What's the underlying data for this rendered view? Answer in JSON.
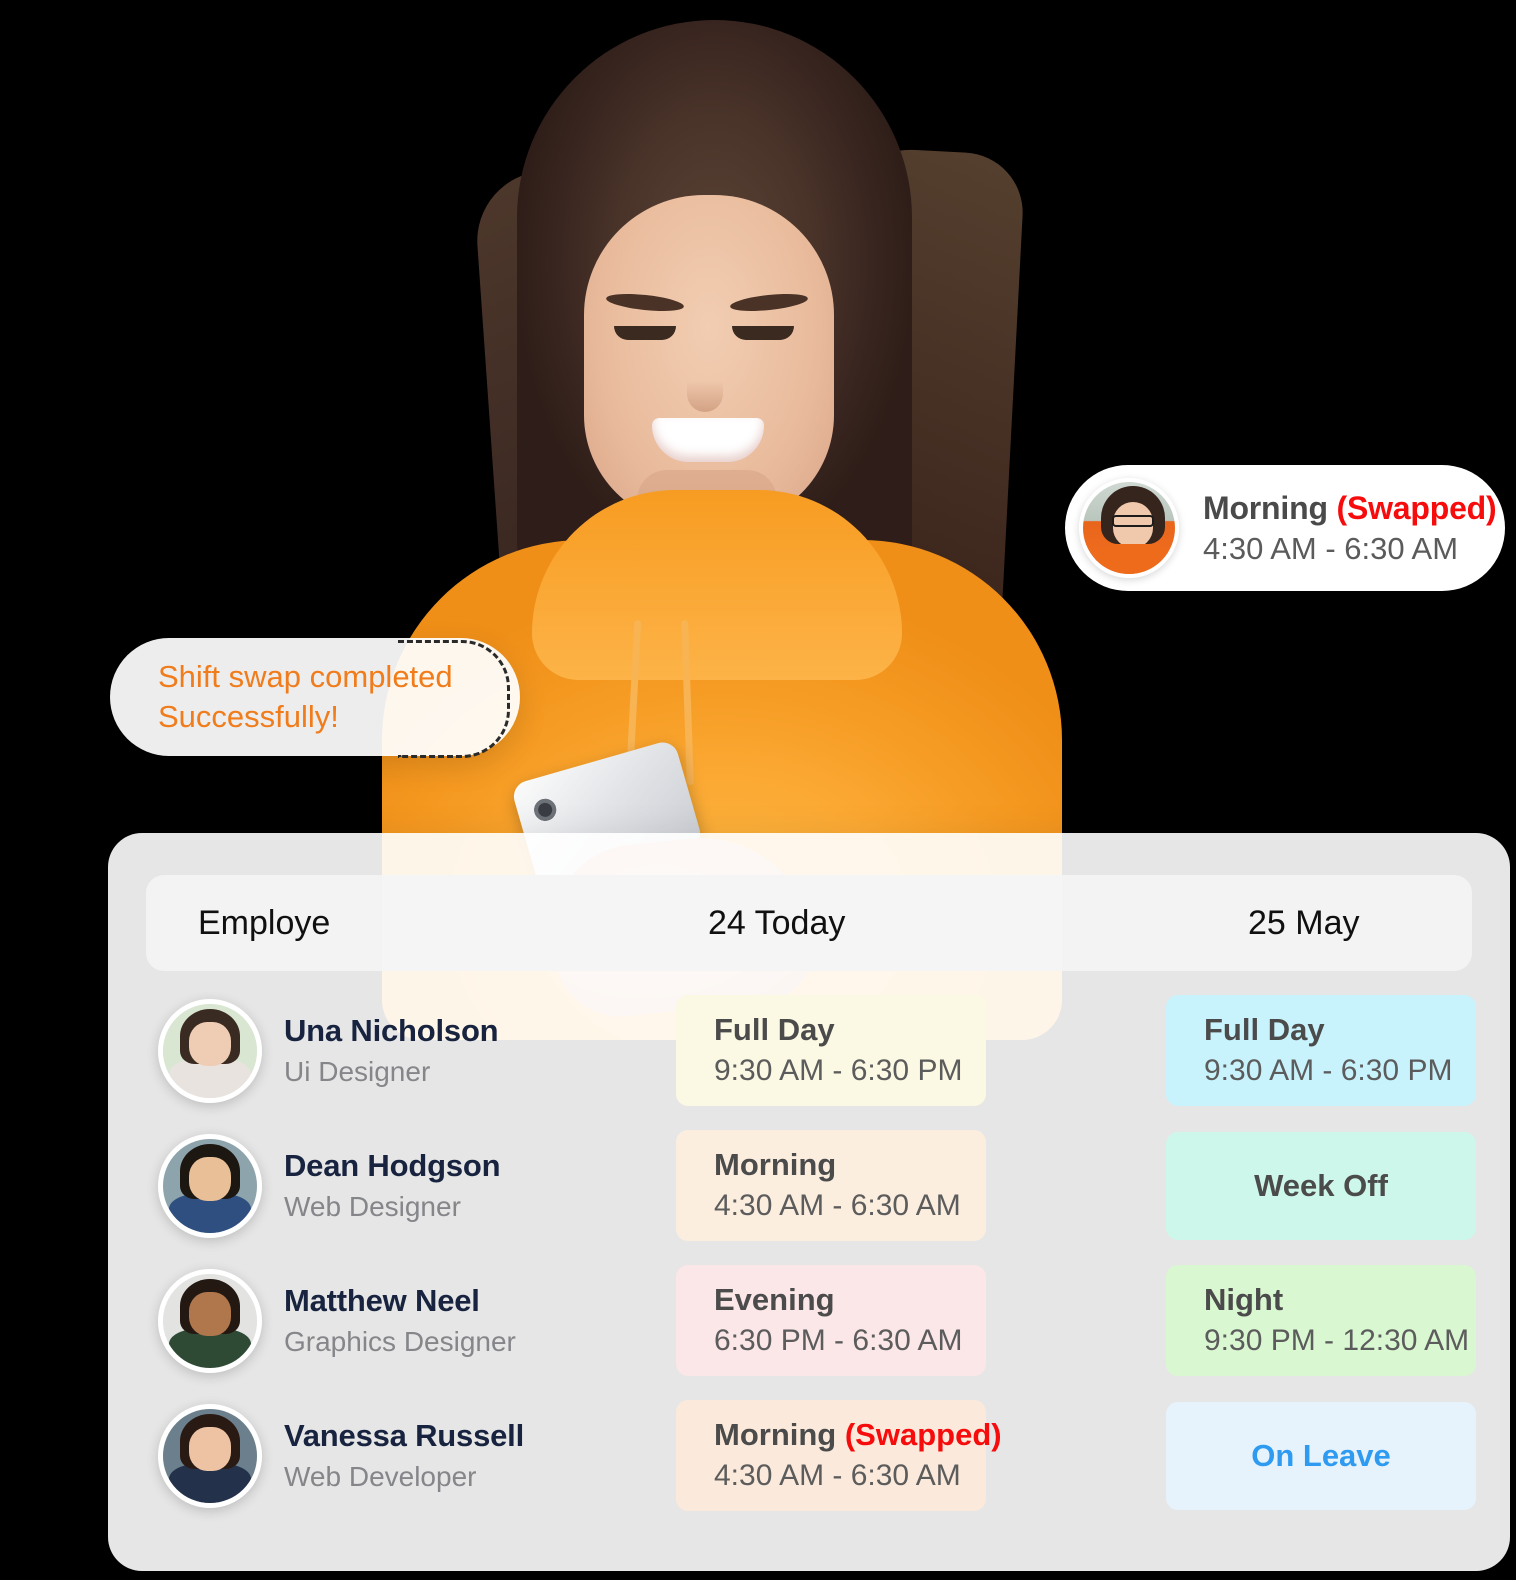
{
  "hero": {
    "alt_name": "smiling-woman-orange-hoodie-with-phone"
  },
  "shift_badge": {
    "avatar_name": "vanessa-avatar",
    "title_main": "Morning ",
    "title_swapped": "(Swapped)",
    "time": "4:30 AM - 6:30 AM"
  },
  "toast": {
    "line1": "Shift swap completed",
    "line2": "Successfully!",
    "color": "#f07c1b"
  },
  "schedule": {
    "columns": {
      "employee": "Employe",
      "today": "24 Today",
      "next_day": "25 May"
    },
    "rows": [
      {
        "name": "Una Nicholson",
        "role": "Ui Designer",
        "avatar_name": "una-nicholson-avatar",
        "avatar_colors": {
          "bg": "#d9e6d2",
          "hair": "#3a2b22",
          "face": "#efcdb4",
          "body": "#e9e3e0"
        },
        "today": {
          "title": "Full Day",
          "swapped": "",
          "time": "9:30 AM - 6:30 PM",
          "bg": "#fbf8e3",
          "layout": "two-line"
        },
        "next_day": {
          "title": "Full Day",
          "swapped": "",
          "time": "9:30 AM - 6:30 PM",
          "bg": "#c9f3fc",
          "layout": "two-line"
        }
      },
      {
        "name": "Dean Hodgson",
        "role": "Web Designer",
        "avatar_name": "dean-hodgson-avatar",
        "avatar_colors": {
          "bg": "#8ea4ad",
          "hair": "#1d1712",
          "face": "#e8bf96",
          "body": "#2f4f80"
        },
        "today": {
          "title": "Morning",
          "swapped": "",
          "time": "4:30 AM - 6:30 AM",
          "bg": "#fbeedf",
          "layout": "two-line"
        },
        "next_day": {
          "title": "Week Off",
          "swapped": "",
          "time": "",
          "bg": "#cdf7ea",
          "layout": "single"
        }
      },
      {
        "name": "Matthew Neel",
        "role": "Graphics Designer",
        "avatar_name": "matthew-neel-avatar",
        "avatar_colors": {
          "bg": "#e3e3e1",
          "hair": "#241812",
          "face": "#b1774c",
          "body": "#2e4a35"
        },
        "today": {
          "title": "Evening",
          "swapped": "",
          "time": "6:30 PM - 6:30 AM",
          "bg": "#fbe6e8",
          "layout": "two-line"
        },
        "next_day": {
          "title": "Night",
          "swapped": "",
          "time": "9:30 PM - 12:30 AM",
          "bg": "#d9f8d1",
          "layout": "two-line"
        }
      },
      {
        "name": "Vanessa Russell",
        "role": "Web Developer",
        "avatar_name": "vanessa-russell-avatar",
        "avatar_colors": {
          "bg": "#6b7f8c",
          "hair": "#2a1a14",
          "face": "#eec3a4",
          "body": "#23324a"
        },
        "today": {
          "title": "Morning ",
          "swapped": "(Swapped)",
          "time": "4:30 AM - 6:30 AM",
          "bg": "#fbeadb",
          "layout": "two-line"
        },
        "next_day": {
          "title": "On Leave",
          "swapped": "",
          "time": "",
          "bg": "#e7f3fc",
          "layout": "single-accent"
        }
      }
    ]
  },
  "colors": {
    "brand_orange": "#f07c1b",
    "swap_red": "#f60c0c",
    "leave_blue": "#2e9bf0",
    "name_navy": "#17233f",
    "role_gray": "#85868a"
  }
}
